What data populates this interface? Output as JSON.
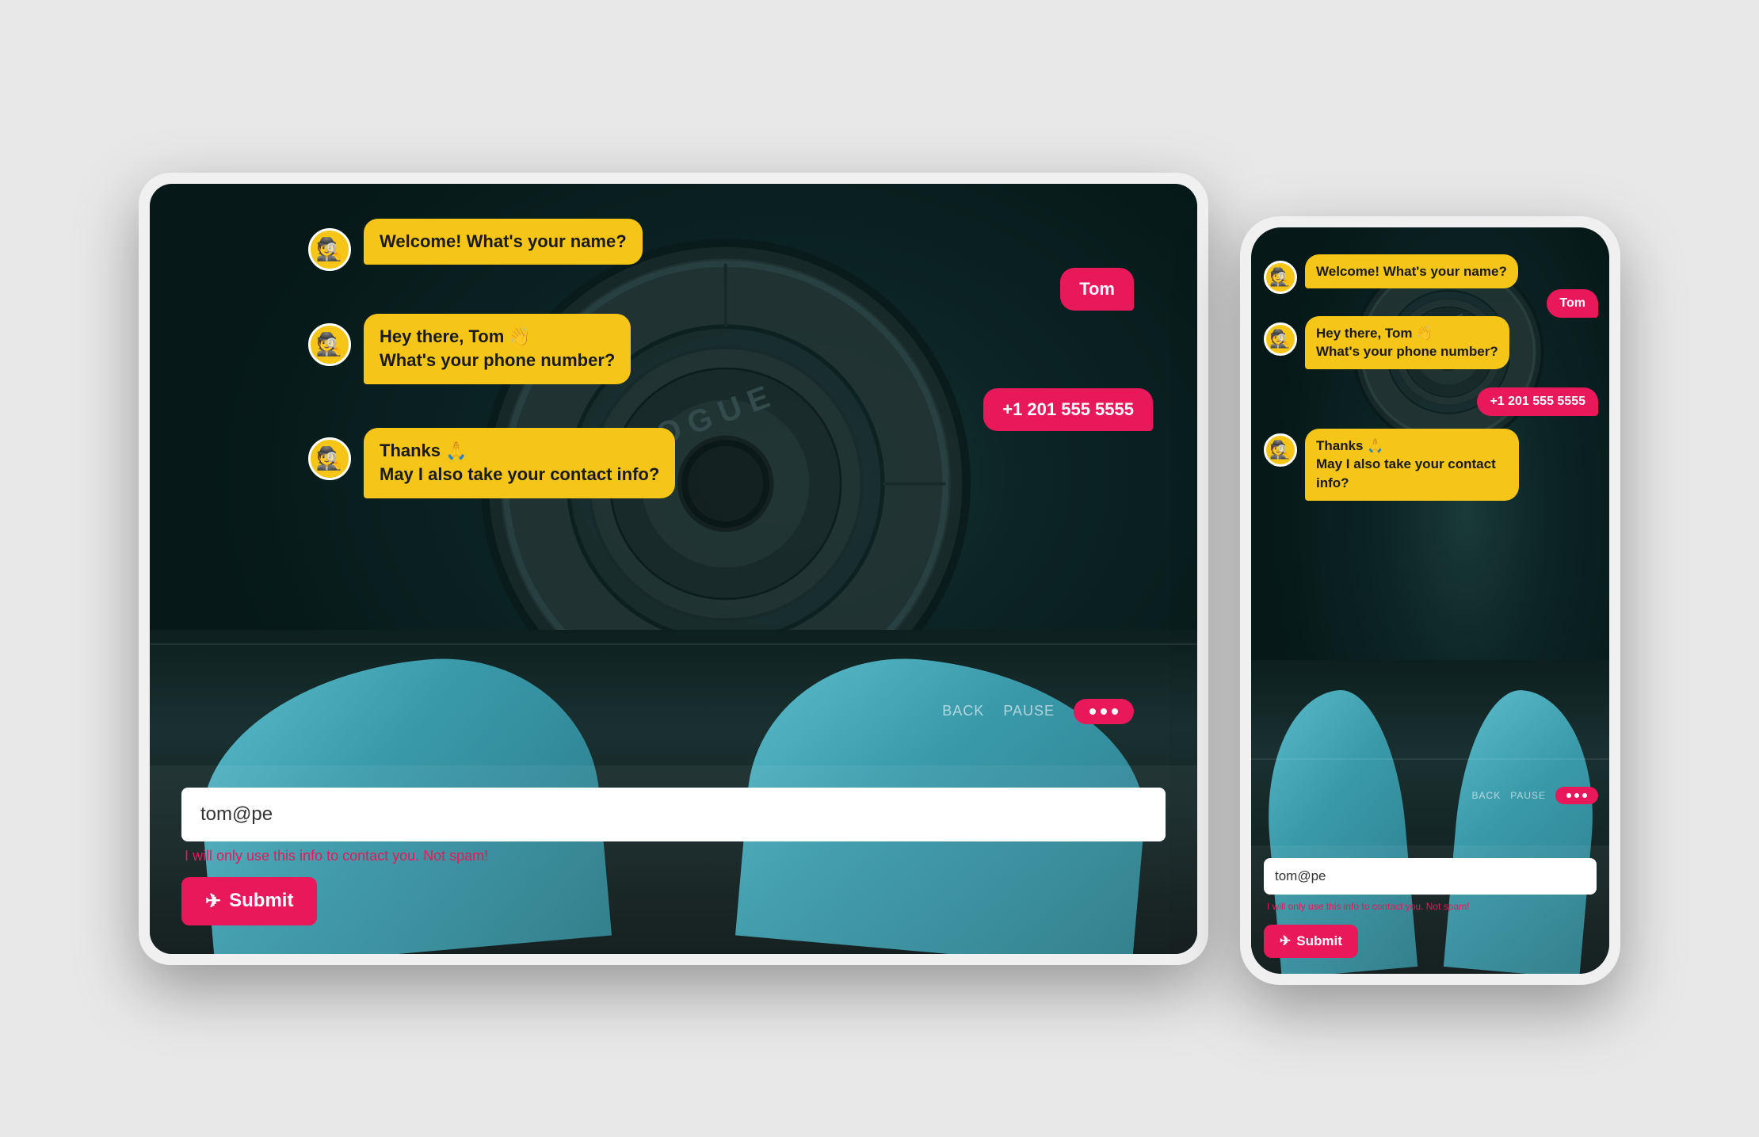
{
  "tablet": {
    "chat": {
      "bot_avatar_emoji": "🕵️",
      "message_1": "Welcome! What's your name?",
      "user_reply_1": "Tom",
      "message_2_line1": "Hey there, Tom 👋",
      "message_2_line2": "What's your phone number?",
      "user_reply_2": "+1 201 555 5555",
      "message_3_line1": "Thanks 🙏",
      "message_3_line2": "May I also take your contact info?",
      "input_value": "tom@pe",
      "privacy_text": "I will only use this info to contact you. Not spam!",
      "submit_label": "Submit",
      "back_label": "BACK",
      "pause_label": "PAUSE"
    }
  },
  "phone": {
    "chat": {
      "bot_avatar_emoji": "🕵️",
      "message_1": "Welcome! What's your name?",
      "user_reply_1": "Tom",
      "message_2_line1": "Hey there, Tom 👋",
      "message_2_line2": "What's your phone number?",
      "user_reply_2": "+1 201 555 5555",
      "message_3_line1": "Thanks 🙏",
      "message_3_line2": "May I also take your contact info?",
      "input_value": "tom@pe",
      "privacy_text": "I will only use this info to contact you. Not spam!",
      "submit_label": "Submit",
      "back_label": "BACK",
      "pause_label": "PAUSE"
    }
  },
  "colors": {
    "bot_bubble": "#f5c518",
    "user_bubble": "#e8185a",
    "submit_bg": "#e8185a",
    "accent": "#e8185a"
  },
  "icons": {
    "send": "✈",
    "dots": "•••"
  }
}
